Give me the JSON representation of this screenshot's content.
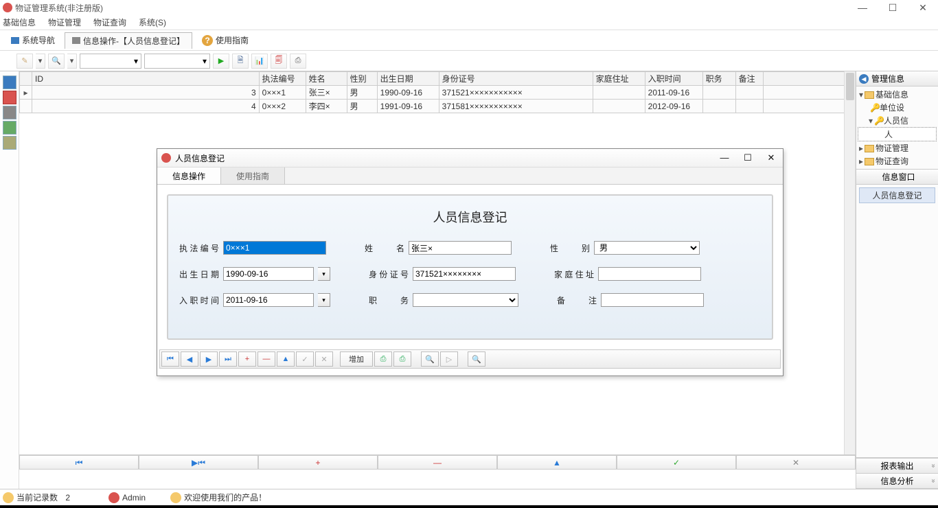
{
  "window": {
    "title": "物证管理系统(非注册版)",
    "controls": {
      "min": "—",
      "max": "☐",
      "close": "✕"
    }
  },
  "menubar": [
    "基础信息",
    "物证管理",
    "物证查询",
    "系统(S)"
  ],
  "tabband": {
    "nav": "系统导航",
    "ops": "信息操作-【人员信息登记】",
    "help": "使用指南"
  },
  "grid": {
    "headers": [
      "ID",
      "执法编号",
      "姓名",
      "性别",
      "出生日期",
      "身份证号",
      "家庭住址",
      "入职时间",
      "职务",
      "备注"
    ],
    "rows": [
      {
        "hdr": "▸",
        "cells": [
          "3",
          "0×××1",
          "张三×",
          "男",
          "1990-09-16",
          "371521×××××××××××",
          "",
          "2011-09-16",
          "",
          ""
        ]
      },
      {
        "hdr": "",
        "cells": [
          "4",
          "0×××2",
          "李四×",
          "男",
          "1991-09-16",
          "371581×××××××××××",
          "",
          "2012-09-16",
          "",
          ""
        ]
      }
    ]
  },
  "nav_footer": {
    "first": "⏮",
    "prev": "▶⏮",
    "add": "+",
    "del": "—",
    "up": "▲",
    "ok": "✓",
    "cancel": "✕"
  },
  "tree": {
    "title": "管理信息",
    "items": {
      "root": "基础信息",
      "n1": "单位设",
      "n2": "人员信",
      "n3": "人",
      "n4": "物证管理",
      "n5": "物证查询"
    }
  },
  "info_panel": {
    "title": "信息窗口",
    "item": "人员信息登记"
  },
  "accordion": {
    "a1": "报表输出",
    "a2": "信息分析"
  },
  "status": {
    "count_label": "当前记录数",
    "count_val": "2",
    "user": "Admin",
    "welcome": "欢迎使用我们的产品！"
  },
  "modal": {
    "title": "人员信息登记",
    "tabs": {
      "t1": "信息操作",
      "t2": "使用指南"
    },
    "heading": "人员信息登记",
    "controls": {
      "min": "—",
      "max": "☐",
      "close": "✕"
    },
    "labels": {
      "code": "执法编号",
      "name": "姓　　名",
      "sex": "性　　别",
      "birth": "出生日期",
      "idno": "身份证号",
      "addr": "家庭住址",
      "hire": "入职时间",
      "job": "职　　务",
      "note": "备　　注"
    },
    "values": {
      "code": "0×××1",
      "name": "张三×",
      "sex": "男",
      "birth": "1990-09-16",
      "idno": "371521××××××××",
      "addr": "",
      "hire": "2011-09-16",
      "job": "",
      "note": ""
    },
    "btn_add": "增加"
  }
}
